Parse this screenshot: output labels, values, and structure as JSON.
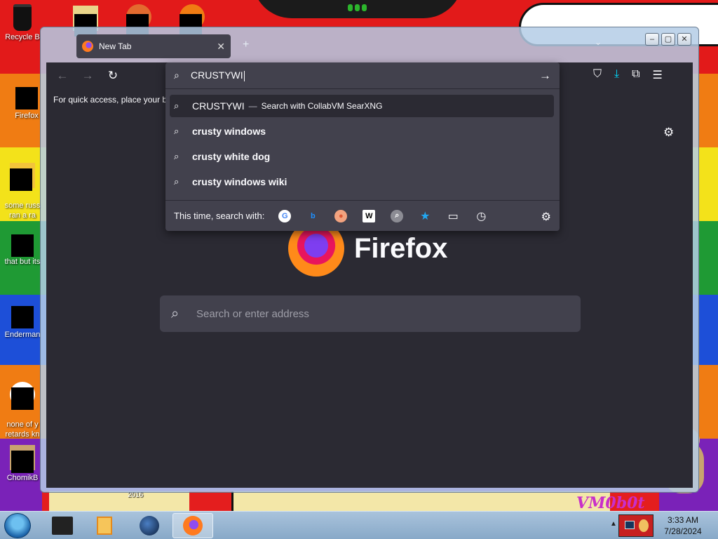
{
  "desktop": {
    "icons": [
      {
        "label": "Recycle B",
        "name": "recycle-bin"
      },
      {
        "label": "Firefox",
        "name": "firefox"
      },
      {
        "label": "some russ\nran a ra",
        "name": "some-russ"
      },
      {
        "label": "that but its",
        "name": "that-but-its"
      },
      {
        "label": "Enderman",
        "name": "enderman"
      },
      {
        "label": "none of y\nretards kn",
        "name": "none-of-y"
      },
      {
        "label": "ChomikB",
        "name": "chomik"
      }
    ],
    "year_text": "2016",
    "vmbot_text": "VM0b0t"
  },
  "browser": {
    "tab_title": "New Tab",
    "url_value": "CRUSTYWI",
    "bookmark_bar_text": "For quick access, place your b",
    "wordmark": "Firefox",
    "page_search_placeholder": "Search or enter address",
    "dropdown": {
      "first_result": {
        "text": "CRUSTYWI",
        "separator": "—",
        "action": "Search with CollabVM SearXNG"
      },
      "suggestions": [
        "crusty windows",
        "crusty white dog",
        "crusty windows wiki"
      ],
      "engines_label": "This time, search with:",
      "engines": [
        {
          "name": "google-engine-icon",
          "glyph": "G",
          "color": "#4285f4",
          "bg": "#ffffff"
        },
        {
          "name": "bing-engine-icon",
          "glyph": "b",
          "color": "#1e90ff",
          "bg": "transparent"
        },
        {
          "name": "duckduckgo-engine-icon",
          "glyph": "●",
          "color": "#de5833",
          "bg": "#f3a37f"
        },
        {
          "name": "wikipedia-engine-icon",
          "glyph": "W",
          "color": "#000000",
          "bg": "#ffffff"
        },
        {
          "name": "searxng-engine-icon",
          "glyph": "⌕",
          "color": "#ffffff",
          "bg": "#8c8c94"
        },
        {
          "name": "bookmarks-icon",
          "glyph": "★",
          "color": "#22a7f0",
          "bg": "transparent"
        },
        {
          "name": "tabs-icon",
          "glyph": "▭",
          "color": "#fbfbfe",
          "bg": "transparent"
        },
        {
          "name": "history-icon",
          "glyph": "◷",
          "color": "#fbfbfe",
          "bg": "transparent"
        }
      ]
    }
  },
  "taskbar": {
    "time": "3:33 AM",
    "date": "7/28/2024"
  }
}
